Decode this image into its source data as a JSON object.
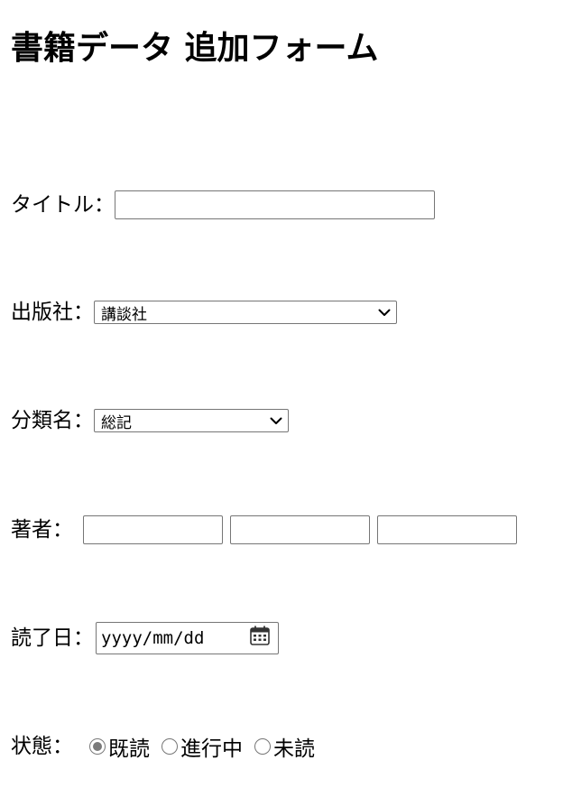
{
  "form": {
    "title": "書籍データ 追加フォーム",
    "title_field": {
      "label": "タイトル：",
      "value": ""
    },
    "publisher_field": {
      "label": "出版社：",
      "selected": "講談社"
    },
    "category_field": {
      "label": "分類名：",
      "selected": "総記"
    },
    "author_field": {
      "label": "著者：",
      "values": [
        "",
        "",
        ""
      ]
    },
    "read_date_field": {
      "label": "読了日：",
      "placeholder": "yyyy/mm/dd"
    },
    "status_field": {
      "label": "状態：",
      "options": [
        {
          "label": "既読",
          "checked": true
        },
        {
          "label": "進行中",
          "checked": false
        },
        {
          "label": "未読",
          "checked": false
        }
      ]
    }
  },
  "icons": {
    "select_arrow": "chevron-down-icon",
    "date_picker": "calendar-icon"
  },
  "colors": {
    "border": "#767676",
    "radio_checked": "#7a7a7a",
    "text": "#000000",
    "background": "#ffffff"
  }
}
